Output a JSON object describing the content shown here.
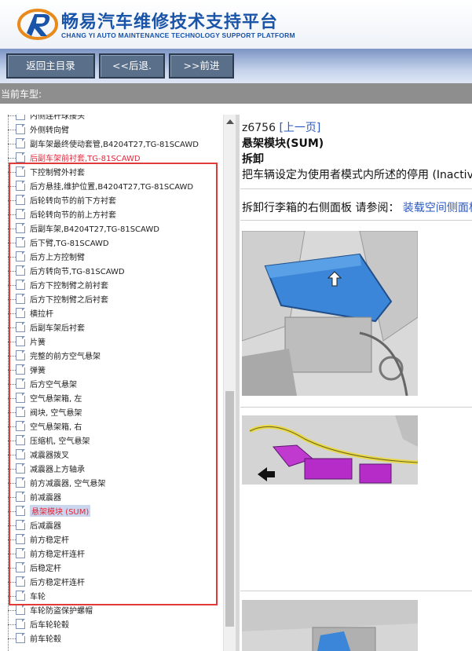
{
  "header": {
    "title_cn": "畅易汽车维修技术支持平台",
    "title_en": "CHANG YI AUTO MAINTENANCE TECHNOLOGY SUPPORT PLATFORM",
    "brand_color": "#1a54a8"
  },
  "nav": {
    "home_label": "返回主目录",
    "back_label": "<<后退.",
    "forward_label": ">>前进"
  },
  "vehicle": {
    "label": "当前车型:"
  },
  "tree": {
    "items": [
      "内侧连杆球接头",
      "外侧转向臂",
      "副车架最终使动套管,B4204T27,TG-81SCAWD",
      "后副车架前衬套,TG-81SCAWD",
      "下控制臂外衬套",
      "后方悬挂,维护位置,B4204T27,TG-81SCAWD",
      "后轮转向节的前下方衬套",
      "后轮转向节的前上方衬套",
      "后副车架,B4204T27,TG-81SCAWD",
      "后下臂,TG-81SCAWD",
      "后方上方控制臂",
      "后方转向节,TG-81SCAWD",
      "后方下控制臂之前衬套",
      "后方下控制臂之后衬套",
      "横拉杆",
      "后副车架后衬套",
      "片簧",
      "完整的前方空气悬架",
      "弹簧",
      "后方空气悬架",
      "空气悬架箱, 左",
      "阀块, 空气悬架",
      "空气悬架箱, 右",
      "压缩机, 空气悬架",
      "减震器拨叉",
      "减震器上方轴承",
      "前方减震器, 空气悬架",
      "前减震器",
      "悬架模块 (SUM)",
      "后减震器",
      "前方稳定杆",
      "前方稳定杆连杆",
      "后稳定杆",
      "后方稳定杆连杆",
      "车轮",
      "车轮防盗保护螺帽",
      "后车轮轮毂",
      "前车轮毂"
    ],
    "highlight_index": 3,
    "selected_index": 28,
    "highlight_color": "#e0283c",
    "box_color": "#e03a3a"
  },
  "content": {
    "doc_code": "z6756",
    "prev_link": "[上一页]",
    "title": "悬架模块(SUM)",
    "section": "拆卸",
    "step1": "把车辆设定为使用者模式内所述的停用 (Inactive)",
    "step2_prefix": "拆卸行李箱的右侧面板 请参阅：",
    "step2_link": "装载空间侧面板",
    "link_color": "#2b59c3"
  }
}
